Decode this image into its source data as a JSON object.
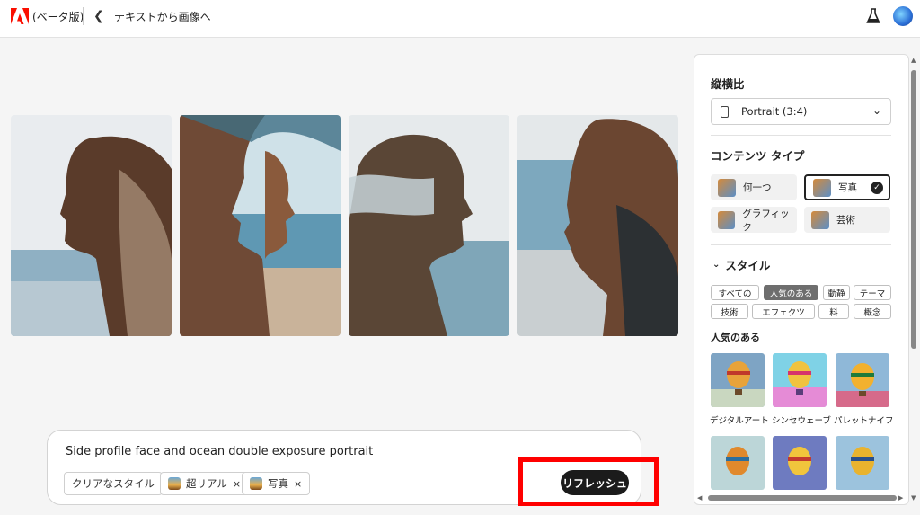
{
  "topbar": {
    "beta_label": "(ベータ版)",
    "title": "テキストから画像へ"
  },
  "gallery": {
    "images": [
      {
        "alt": "image-1"
      },
      {
        "alt": "image-2"
      },
      {
        "alt": "image-3"
      },
      {
        "alt": "image-4"
      }
    ]
  },
  "prompt": {
    "text": "Side profile face and ocean double exposure portrait",
    "chips": [
      {
        "label": "クリアなスタイル",
        "removable": false
      },
      {
        "label": "超リアル",
        "removable": true
      },
      {
        "label": "写真",
        "removable": true
      }
    ],
    "chip_close": "×",
    "refresh_label": "リフレッシュ"
  },
  "panel": {
    "aspect_title": "縦横比",
    "aspect_value": "Portrait (3:4)",
    "content_type_title": "コンテンツ タイプ",
    "content_types": [
      {
        "label": "何一つ",
        "selected": false
      },
      {
        "label": "写真",
        "selected": true
      },
      {
        "label": "グラフィック",
        "selected": false
      },
      {
        "label": "芸術",
        "selected": false
      }
    ],
    "style_title": "スタイル",
    "filters_row1": [
      "すべての",
      "人気のある",
      "動静",
      "テーマ"
    ],
    "filters_row2": [
      "技術",
      "エフェクツ",
      "料",
      "概念"
    ],
    "active_filter": "人気のある",
    "popular_title": "人気のある",
    "styles": [
      {
        "label": "デジタルアート"
      },
      {
        "label": "シンセウェーブ"
      },
      {
        "label": "パレットナイフ"
      }
    ]
  },
  "colors": {
    "accent_red": "#ff0000",
    "button_dark": "#1b1b1b",
    "adobe_red": "#fa0f00"
  }
}
